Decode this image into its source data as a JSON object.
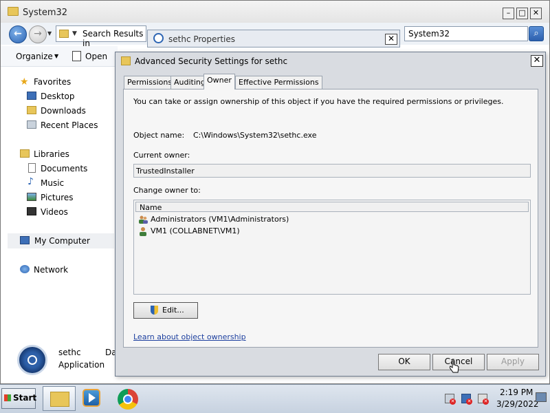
{
  "explorer": {
    "title": "System32",
    "address": "Search Results in",
    "search_value": "System32",
    "toolbar": {
      "organize": "Organize",
      "open": "Open"
    },
    "nav": {
      "favorites": "Favorites",
      "desktop": "Desktop",
      "downloads": "Downloads",
      "recent_places": "Recent Places",
      "libraries": "Libraries",
      "documents": "Documents",
      "music": "Music",
      "pictures": "Pictures",
      "videos": "Videos",
      "my_computer": "My Computer",
      "network": "Network"
    },
    "status": {
      "name": "sethc",
      "type": "Application",
      "extra": "Da"
    }
  },
  "properties_tab": {
    "title": "sethc Properties"
  },
  "dialog": {
    "title": "Advanced Security Settings for sethc",
    "tabs": [
      "Permissions",
      "Auditing",
      "Owner",
      "Effective Permissions"
    ],
    "active_tab": "Owner",
    "info": "You can take or assign ownership of this object if you have the required permissions or privileges.",
    "object_name_label": "Object name:",
    "object_name_value": "C:\\Windows\\System32\\sethc.exe",
    "current_owner_label": "Current owner:",
    "current_owner_value": "TrustedInstaller",
    "change_owner_label": "Change owner to:",
    "list_header": "Name",
    "owners": [
      "Administrators (VM1\\Administrators)",
      "VM1 (COLLABNET\\VM1)"
    ],
    "edit_button": "Edit...",
    "learn_link": "Learn about object ownership",
    "ok": "OK",
    "cancel": "Cancel",
    "apply": "Apply"
  },
  "taskbar": {
    "start": "Start",
    "time": "2:19 PM",
    "date": "3/29/2022"
  },
  "icons": {
    "back": "back-arrow-icon",
    "forward": "forward-arrow-icon",
    "search": "search-icon",
    "shield": "uac-shield-icon"
  },
  "colors": {
    "link": "#1b3e9e",
    "accent": "#2c64b3",
    "folder": "#e8c65a"
  }
}
